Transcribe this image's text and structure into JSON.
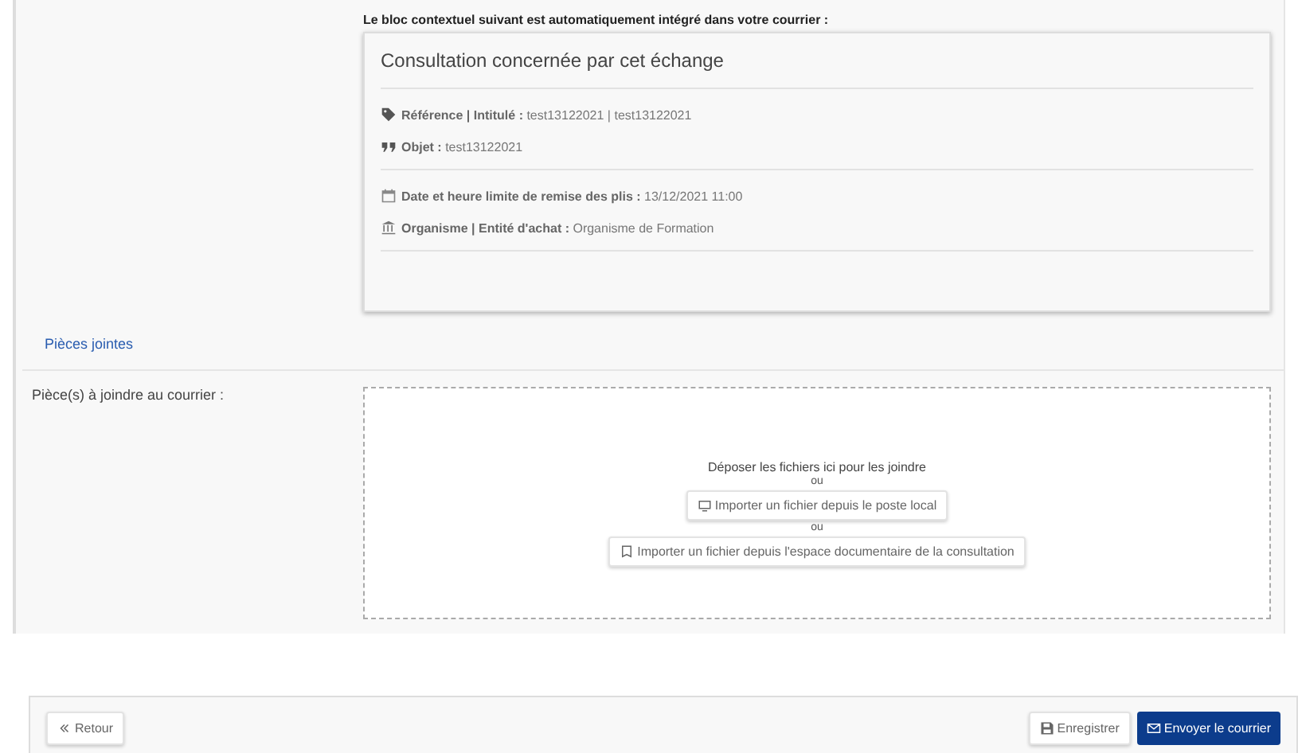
{
  "context_intro": "Le bloc contextuel suivant est automatiquement intégré dans votre courrier :",
  "context_card": {
    "title": "Consultation concernée par cet échange",
    "groups": [
      [
        {
          "kind": "tag",
          "label": "Référence | Intitulé :",
          "value": "test13122021 | test13122021"
        },
        {
          "kind": "quote",
          "label": "Objet :",
          "value": "test13122021"
        }
      ],
      [
        {
          "kind": "calendar",
          "label": "Date et heure limite de remise des plis :",
          "value": "13/12/2021 11:00"
        },
        {
          "kind": "building",
          "label": "Organisme | Entité d'achat :",
          "value": "Organisme de Formation"
        }
      ]
    ]
  },
  "attachments_link": "Pièces jointes",
  "attachments_label": "Pièce(s) à joindre au courrier :",
  "dropzone": {
    "text": "Déposer les fichiers ici pour les joindre",
    "or_1": "ou",
    "local_button": "Importer un fichier depuis le poste local",
    "or_2": "ou",
    "space_button": "Importer un fichier depuis l'espace documentaire de la consultation"
  },
  "footer": {
    "back": "Retour",
    "save": "Enregistrer",
    "send": "Envoyer le courrier"
  }
}
